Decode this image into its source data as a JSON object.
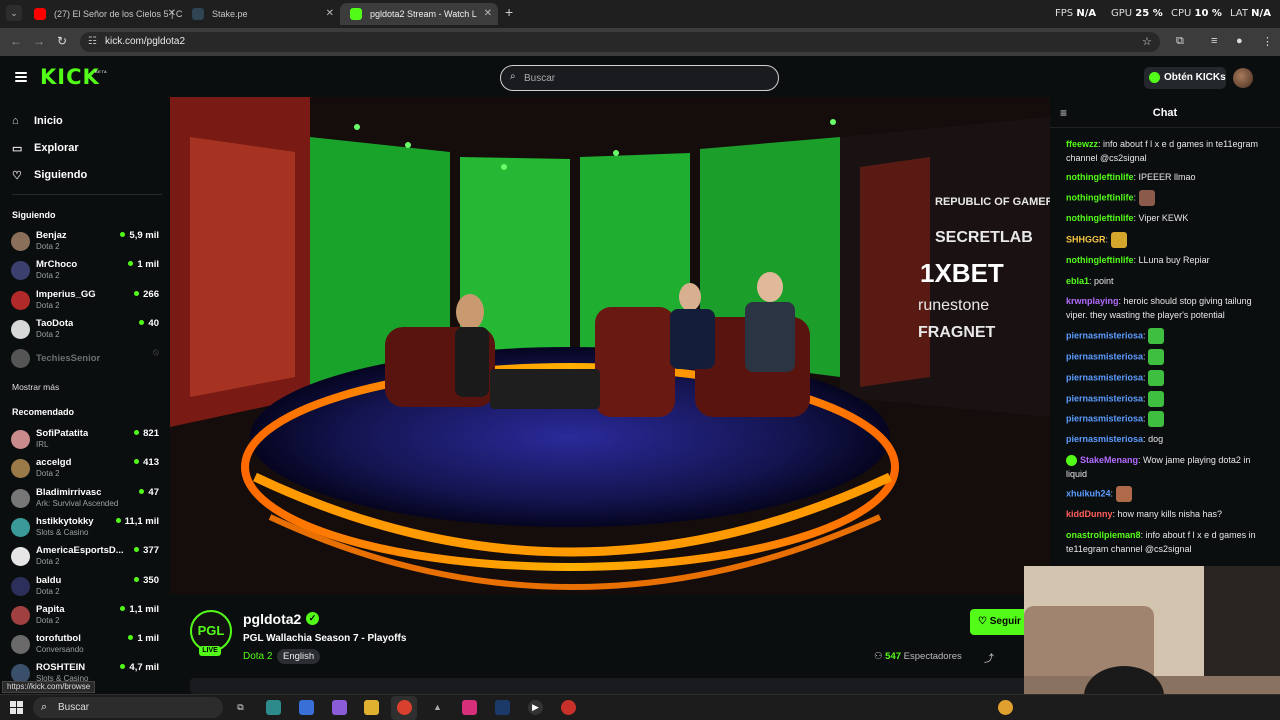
{
  "browser": {
    "tabs": [
      {
        "title": "(27) El Señor de los Cielos 5 | C",
        "favicon_color": "#ff0000"
      },
      {
        "title": "Stake.pe",
        "favicon_color": "#2f4553"
      },
      {
        "title": "pgldota2 Stream - Watch L",
        "favicon_color": "#53fc18"
      }
    ],
    "url": "kick.com/pgldota2",
    "osd": {
      "fps_label": "FPS",
      "fps_value": "N/A",
      "gpu_label": "GPU",
      "gpu_value": "25 %",
      "cpu_label": "CPU",
      "cpu_value": "10 %",
      "lat_label": "LAT",
      "lat_value": "N/A"
    }
  },
  "header": {
    "logo": "KICK",
    "beta": "BETA",
    "search_placeholder": "Buscar",
    "kicks_button": "Obtén KICKs"
  },
  "sidebar": {
    "nav": [
      {
        "label": "Inicio",
        "icon": "home-icon"
      },
      {
        "label": "Explorar",
        "icon": "browse-icon"
      },
      {
        "label": "Siguiendo",
        "icon": "heart-icon"
      }
    ],
    "following_title": "Siguiendo",
    "following": [
      {
        "name": "Benjaz",
        "category": "Dota 2",
        "viewers": "5,9 mil",
        "color": "#8a6f5a"
      },
      {
        "name": "MrChoco",
        "category": "Dota 2",
        "viewers": "1 mil",
        "color": "#3b3f6e"
      },
      {
        "name": "Imperius_GG",
        "category": "Dota 2",
        "viewers": "266",
        "color": "#b02a2a"
      },
      {
        "name": "TaoDota",
        "category": "Dota 2",
        "viewers": "40",
        "color": "#d8d8d8"
      }
    ],
    "offline": {
      "name": "TechiesSenior",
      "color": "#555"
    },
    "show_more": "Mostrar más",
    "recommended_title": "Recomendado",
    "recommended": [
      {
        "name": "SofiPatatita",
        "category": "IRL",
        "viewers": "821",
        "color": "#c98b8b"
      },
      {
        "name": "accelgd",
        "category": "Dota 2",
        "viewers": "413",
        "color": "#9b7a4a"
      },
      {
        "name": "Bladimirrivasc",
        "category": "Ark: Survival Ascended",
        "viewers": "47",
        "color": "#777"
      },
      {
        "name": "hstikkytokky",
        "category": "Slots & Casino",
        "viewers": "11,1 mil",
        "color": "#3a9a9a"
      },
      {
        "name": "AmericaEsportsD...",
        "category": "Dota 2",
        "viewers": "377",
        "color": "#e6e6e6"
      },
      {
        "name": "baldu",
        "category": "Dota 2",
        "viewers": "350",
        "color": "#2b2f5a"
      },
      {
        "name": "Papita",
        "category": "Dota 2",
        "viewers": "1,1 mil",
        "color": "#a04040"
      },
      {
        "name": "torofutbol",
        "category": "Conversando",
        "viewers": "1 mil",
        "color": "#6a6a6a"
      },
      {
        "name": "ROSHTEIN",
        "category": "Slots & Casino",
        "viewers": "4,7 mil",
        "color": "#3a4f6a"
      }
    ]
  },
  "stream": {
    "avatar_text": "PGL",
    "live": "LIVE",
    "name": "pgldota2",
    "title": "PGL Wallachia Season 7 - Playoffs",
    "category": "Dota 2",
    "language": "English",
    "viewers_count": "547",
    "viewers_label": "Espectadores",
    "follow": "Seguir"
  },
  "video": {
    "sponsors": [
      "REPUBLIC OF GAMERS",
      "SECRET LAB",
      "1XBET",
      "runestone",
      "FRAGNET"
    ]
  },
  "chat": {
    "title": "Chat",
    "messages": [
      {
        "user": "ffeewzz",
        "color": "#53fc18",
        "text": "info about f l x e d games in te11egram channel @cs2signal"
      },
      {
        "user": "nothingleftinlife",
        "color": "#53fc18",
        "text": "IPEEER llmao"
      },
      {
        "user": "nothingleftinlife",
        "color": "#53fc18",
        "text": "",
        "emote": "#8b5a4a"
      },
      {
        "user": "nothingleftinlife",
        "color": "#53fc18",
        "text": "Viper KEWK"
      },
      {
        "user": "SHHGGR",
        "color": "#f5c542",
        "text": "",
        "emote": "#d4a72c"
      },
      {
        "user": "nothingleftinlife",
        "color": "#53fc18",
        "text": "LLuna buy Repiar"
      },
      {
        "user": "ebla1",
        "color": "#53fc18",
        "text": "point"
      },
      {
        "user": "krwnplaying",
        "color": "#b36cff",
        "text": "heroic should stop giving tailung viper. they wasting the player's potential"
      },
      {
        "user": "piernasmisteriosa",
        "color": "#5b9cff",
        "text": "",
        "emote": "#3fbf3f"
      },
      {
        "user": "piernasmisteriosa",
        "color": "#5b9cff",
        "text": "",
        "emote": "#3fbf3f"
      },
      {
        "user": "piernasmisteriosa",
        "color": "#5b9cff",
        "text": "",
        "emote": "#3fbf3f"
      },
      {
        "user": "piernasmisteriosa",
        "color": "#5b9cff",
        "text": "",
        "emote": "#3fbf3f"
      },
      {
        "user": "piernasmisteriosa",
        "color": "#5b9cff",
        "text": "",
        "emote": "#3fbf3f"
      },
      {
        "user": "piernasmisteriosa",
        "color": "#5b9cff",
        "text": "dog"
      },
      {
        "user": "StakeMenang",
        "color": "#b36cff",
        "text": "Wow jame playing dota2 in liquid",
        "badge": true
      },
      {
        "user": "xhuikuh24",
        "color": "#5b9cff",
        "text": "",
        "emote": "#b06a4a"
      },
      {
        "user": "kiddDunny",
        "color": "#ff5d5d",
        "text": "how many kills nisha has?"
      },
      {
        "user": "onastrollpieman8",
        "color": "#53fc18",
        "text": "info about f l x e d games in te11egram channel @cs2signal"
      }
    ]
  },
  "status_url": "https://kick.com/browse",
  "taskbar": {
    "search_placeholder": "Buscar"
  }
}
